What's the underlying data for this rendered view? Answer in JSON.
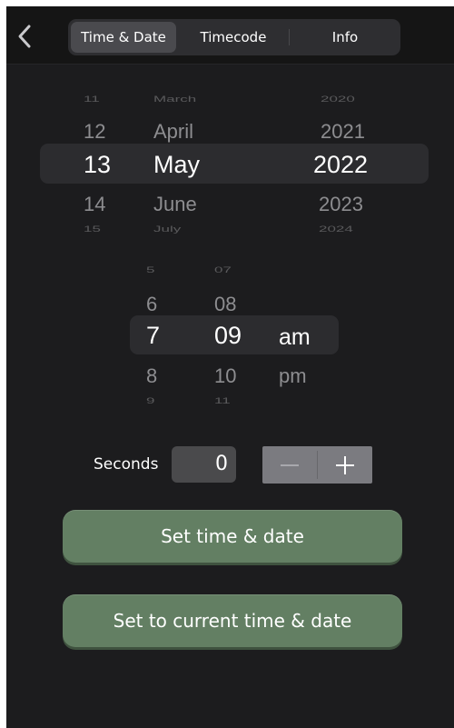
{
  "header": {
    "tabs": [
      {
        "label": "Time & Date",
        "active": true
      },
      {
        "label": "Timecode",
        "active": false
      },
      {
        "label": "Info",
        "active": false
      }
    ]
  },
  "date_picker": {
    "days": [
      "11",
      "12",
      "13",
      "14",
      "15"
    ],
    "months": [
      "March",
      "April",
      "May",
      "June",
      "July"
    ],
    "years": [
      "2020",
      "2021",
      "2022",
      "2023",
      "2024"
    ],
    "selected": {
      "day": "13",
      "month": "May",
      "year": "2022"
    }
  },
  "time_picker": {
    "hours": [
      "5",
      "6",
      "7",
      "8",
      "9"
    ],
    "minutes": [
      "07",
      "08",
      "09",
      "10",
      "11"
    ],
    "periods": [
      "am",
      "pm"
    ],
    "selected": {
      "hour": "7",
      "minute": "09",
      "period": "am"
    }
  },
  "seconds": {
    "label": "Seconds",
    "value": "0",
    "decrement": "−",
    "increment": "+"
  },
  "actions": {
    "set_time_date": "Set time & date",
    "set_current": "Set to current time & date"
  },
  "colors": {
    "background": "#1c1c1e",
    "button_green": "#637f63",
    "stepper": "#7b7b80"
  }
}
